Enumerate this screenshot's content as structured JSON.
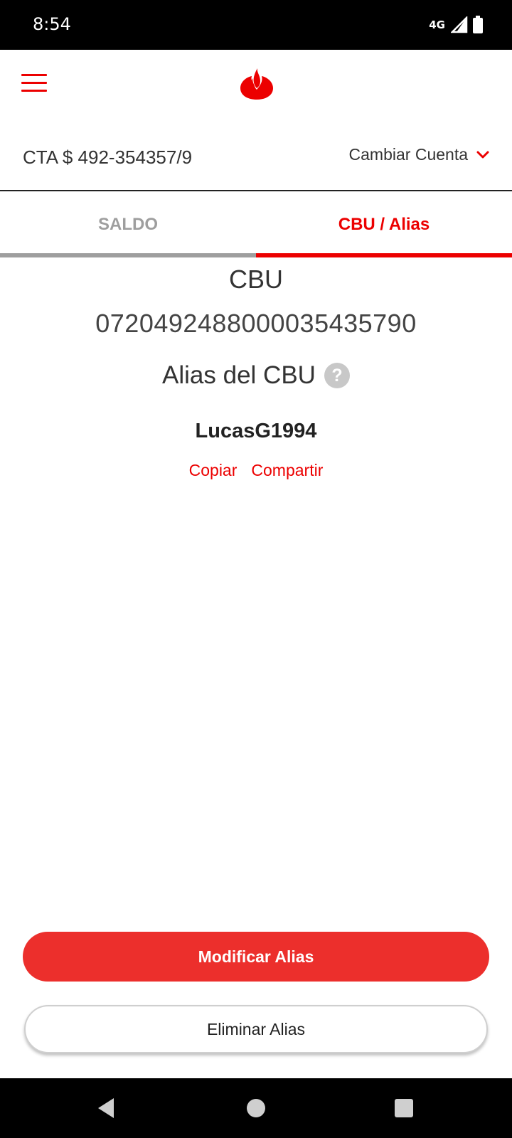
{
  "status_bar": {
    "time": "8:54",
    "network": "4G",
    "icons": [
      "signal-icon",
      "battery-icon"
    ]
  },
  "header": {
    "menu_icon": "hamburger-menu-icon",
    "logo": "santander-flame-logo",
    "brand_color": "#ec0000"
  },
  "account": {
    "label": "CTA $ 492-354357/9",
    "switch_label": "Cambiar Cuenta",
    "switch_icon": "chevron-down-icon"
  },
  "tabs": [
    {
      "label": "SALDO",
      "active": false
    },
    {
      "label": "CBU / Alias",
      "active": true
    }
  ],
  "cbu": {
    "title": "CBU",
    "number": "0720492488000035435790",
    "alias_heading": "Alias del CBU",
    "help_icon": "?",
    "alias_value": "LucasG1994",
    "copy_label": "Copiar",
    "share_label": "Compartir"
  },
  "actions": {
    "modify_label": "Modificar Alias",
    "delete_label": "Eliminar Alias"
  },
  "nav": {
    "back": "back-triangle-icon",
    "home": "home-circle-icon",
    "recents": "recents-square-icon"
  }
}
